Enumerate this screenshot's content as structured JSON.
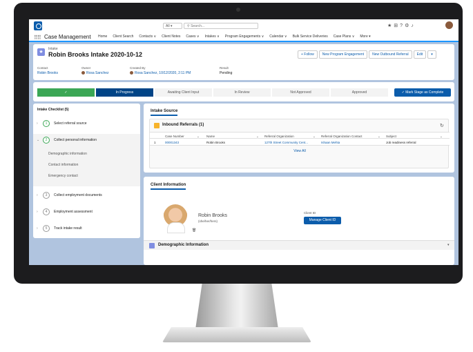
{
  "global": {
    "all_label": "All",
    "search_placeholder": "Search...",
    "app_name": "Case Management"
  },
  "nav": {
    "items": [
      "Home",
      "Client Search",
      "Contacts ∨",
      "Client Notes",
      "Cases ∨",
      "Intakes ∨",
      "Program Engagements ∨",
      "Calendar ∨",
      "Bulk Service Deliveries",
      "Case Plans ∨",
      "More ▾"
    ],
    "active_index": 5
  },
  "record": {
    "object_label": "Intake",
    "title": "Robin Brooks Intake 2020-10-12",
    "buttons": [
      "+ Follow",
      "New Program Engagement",
      "New Outbound Referral",
      "Edit"
    ],
    "fields": [
      {
        "label": "Contact",
        "value": "Robin Brooks"
      },
      {
        "label": "Owner",
        "value": "Rosa Sanchez"
      },
      {
        "label": "Created By",
        "value": "Rosa Sanchez, 10/12/2020, 2:11 PM"
      },
      {
        "label": "Result",
        "value": "Pending"
      }
    ]
  },
  "path": {
    "stages": [
      "✓",
      "In Progress",
      "Awaiting Client Input",
      "In Review",
      "Not Approved",
      "Approved"
    ],
    "mark_button": "✓ Mark Stage as Complete"
  },
  "checklist": {
    "title": "Intake Checklist (5)",
    "steps": [
      {
        "num": "1",
        "label": "Select referral source"
      },
      {
        "num": "2",
        "label": "Collect personal information"
      },
      {
        "num": "3",
        "label": "Collect employment documents"
      },
      {
        "num": "4",
        "label": "Employment assessment"
      },
      {
        "num": "5",
        "label": "Track intake result"
      }
    ],
    "substeps": [
      "Demographic information",
      "Contact information",
      "Emergency contact"
    ]
  },
  "intake_source": {
    "tab": "Intake Source",
    "related_title": "Inbound Referrals (1)",
    "columns": [
      "Case Number",
      "Name",
      "Referral Organization",
      "Referral Organization Contact",
      "Subject"
    ],
    "row": {
      "index": "1",
      "case_number": "00001343",
      "name": "Robin Brooks",
      "org": "127th Street Community Cent...",
      "contact": "Ishaan Mehta",
      "subject": "Job readiness referral"
    },
    "view_all": "View All"
  },
  "client": {
    "tab": "Client Information",
    "name": "Robin Brooks",
    "pronouns": "(she/her/hers)",
    "client_id_label": "Client ID",
    "manage_button": "Manage Client ID",
    "demographic_title": "Demographic Information"
  }
}
